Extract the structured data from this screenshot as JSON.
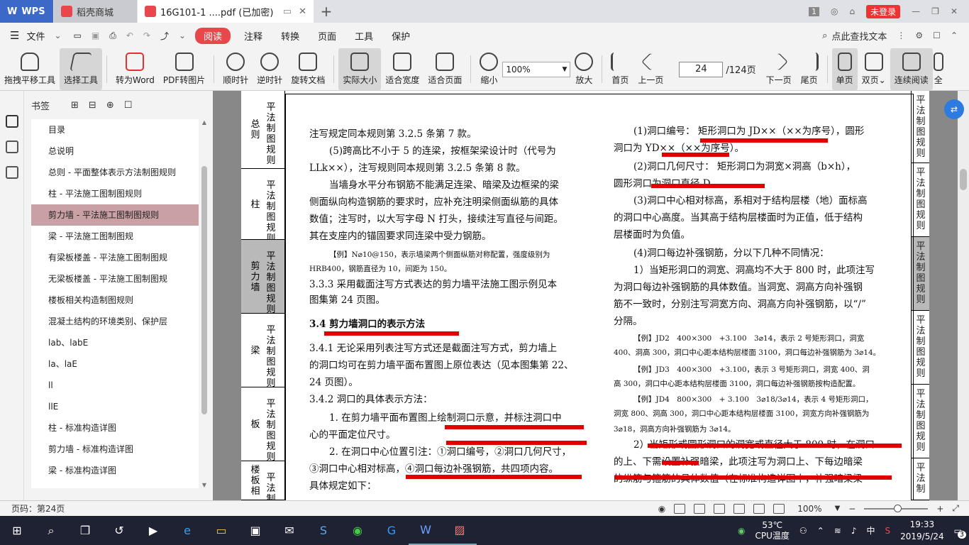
{
  "tabs": [
    {
      "label": "WPS"
    },
    {
      "label": "稻壳商城"
    },
    {
      "label": "16G101-1 ....pdf (已加密)"
    }
  ],
  "window": {
    "page_badge": "1",
    "login_label": "未登录"
  },
  "menu": {
    "file_label": "文件",
    "items": [
      "阅读",
      "注释",
      "转换",
      "页面",
      "工具",
      "保护"
    ],
    "search_label": "点此查找文本"
  },
  "toolbar": {
    "hand": "拖拽平移工具",
    "select": "选择工具",
    "to_word": "转为Word",
    "pdf_img": "PDF转图片",
    "cw": "顺时针",
    "ccw": "逆时针",
    "rotate": "旋转文档",
    "actual": "实际大小",
    "fit_w": "适合宽度",
    "fit_p": "适合页面",
    "zoom_out": "缩小",
    "zoom_value": "100%",
    "zoom_in": "放大",
    "first": "首页",
    "prev": "上一页",
    "page_value": "24",
    "page_total": "/124页",
    "next": "下一页",
    "last": "尾页",
    "single": "单页",
    "double": "双页",
    "continuous": "连续阅读",
    "full": "全"
  },
  "bookmarks": {
    "title": "书签",
    "items": [
      "目录",
      "总说明",
      "总则 - 平面整体表示方法制图规则",
      "柱 - 平法施工图制图规则",
      "剪力墙 - 平法施工图制图规则",
      "梁 - 平法施工图制图规",
      "有梁板楼盖 - 平法施工图制图规",
      "无梁板楼盖 - 平法施工图制图规",
      "楼板相关构造制图规则",
      "混凝土结构的环境类别、保护层",
      "lab、labE",
      "la、laE",
      "ll",
      "llE",
      "柱 - 标准构造详图",
      "剪力墙 - 标准构造详图",
      "梁 - 标准构造详图"
    ],
    "selected_index": 4
  },
  "page_nav_left": [
    {
      "label": "总则",
      "sub": "平法制图规则"
    },
    {
      "label": "柱",
      "sub": "平法制图规则"
    },
    {
      "label": "剪力墙",
      "sub": "平法制图规则"
    },
    {
      "label": "梁",
      "sub": "平法制图规则"
    },
    {
      "label": "板",
      "sub": "平法制图规则"
    },
    {
      "label": "楼板相",
      "sub": "平法制图规"
    }
  ],
  "page_nav_right": [
    "平法制图规则",
    "平法制图规则",
    "平法制图规则",
    "平法制图规则",
    "平法制图规则",
    "平法制"
  ],
  "doc_left": [
    "注写规定同本规则第 3.2.5 条第 7 款。",
    "(5)跨高比不小于 5 的连梁，按框架梁设计时（代号为",
    "LLk××），注写规则同本规则第 3.2.5 条第 8 款。",
    "当墙身水平分布钢筋不能满足连梁、暗梁及边框梁的梁",
    "侧面纵向构造钢筋的要求时，应补充注明梁侧面纵筋的具体",
    "数值；注写时，以大写字母 N 打头，接续注写直径与间距。",
    "其在支座内的锚固要求同连梁中受力钢筋。",
    "【例】N⌀10@150，表示墙梁两个侧面纵筋对称配置，强度级别为",
    "HRB400，钢筋直径为 10，间距为 150。",
    "3.3.3 采用截面注写方式表达的剪力墙平法施工图示例见本",
    "图集第 24 页图。",
    "3.4 剪力墙洞口的表示方法",
    "3.4.1 无论采用列表注写方式还是截面注写方式，剪力墙上",
    "的洞口均可在剪力墙平面布置图上原位表达（见本图集第 22、",
    "24 页图）。",
    "3.4.2 洞口的具体表示方法：",
    "1. 在剪力墙平面布置图上绘制洞口示意，并标注洞口中",
    "心的平面定位尺寸。",
    "2. 在洞口中心位置引注：①洞口编号，②洞口几何尺寸，",
    "③洞口中心相对标高，④洞口每边补强钢筋，共四项内容。",
    "具体规定如下："
  ],
  "doc_right": [
    "(1)洞口编号： 矩形洞口为 JD××（××为序号），圆形",
    "洞口为 YD××（××为序号）。",
    "(2)洞口几何尺寸： 矩形洞口为洞宽×洞高（b×h），",
    "圆形洞口为洞口直径 D。",
    "(3)洞口中心相对标高，系相对于结构层楼（地）面标高",
    "的洞口中心高度。当其高于结构层楼面时为正值，低于结构",
    "层楼面时为负值。",
    "(4)洞口每边补强钢筋，分以下几种不同情况：",
    "1）当矩形洞口的洞宽、洞高均不大于 800 时，此项注写",
    "为洞口每边补强钢筋的具体数值。当洞宽、洞高方向补强钢",
    "筋不一致时，分别注写洞宽方向、洞高方向补强钢筋，以“/”",
    "分隔。",
    "【例】JD2　400×300　+3.100　3⌀14，表示 2 号矩形洞口，洞宽",
    "400、洞高 300，洞口中心距本结构层楼面 3100，洞口每边补强钢筋为 3⌀14。",
    "【例】JD3　400×300　+3.100，表示 3 号矩形洞口，洞宽 400、洞",
    "高 300，洞口中心距本结构层楼面 3100，洞口每边补强钢筋按构造配置。",
    "【例】JD4　800×300　+ 3.100　3⌀18/3⌀14，表示 4 号矩形洞口，",
    "洞宽 800、洞高 300，洞口中心距本结构层楼面 3100，洞宽方向补强钢筋为",
    "3⌀18，洞高方向补强钢筋为 3⌀14。",
    "2）当矩形或圆形洞口的洞宽或直径大于 800 时，在洞口",
    "的上、下需设置补强暗梁，此项注写为洞口上、下每边暗梁",
    "的纵筋与箍筋的具体数值（在标准构造详图中，补强暗梁梁"
  ],
  "status": {
    "page_label": "页码：第24页",
    "zoom": "100%"
  },
  "taskbar": {
    "temp": "53℃",
    "temp_label": "CPU温度",
    "ime": "中",
    "time": "19:33",
    "date": "2019/5/24",
    "notif": "3"
  },
  "colors": {
    "accent": "#e8474c",
    "wps_blue": "#3c68c8",
    "annotation_red": "#e00000"
  }
}
